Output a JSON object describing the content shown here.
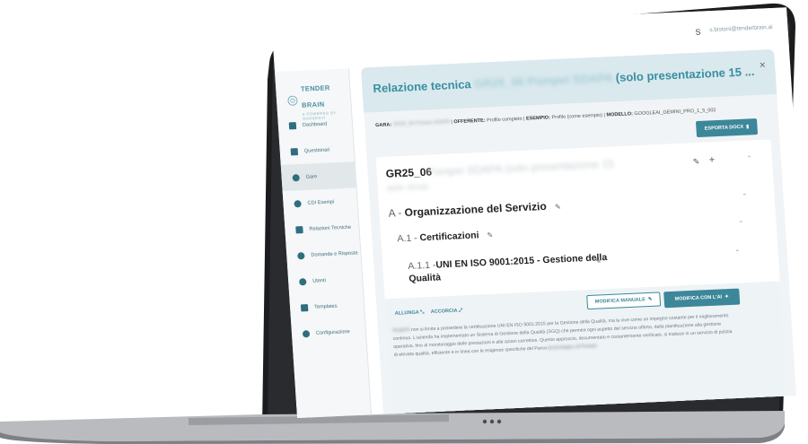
{
  "user": {
    "initial": "S",
    "email": "s.bistoni@tenderbrain.ai"
  },
  "brand": {
    "name": "TENDER BRAIN",
    "tagline": "A POWERED BY SORGENTI"
  },
  "sidebar": {
    "items": [
      {
        "label": "Dashboard",
        "icon": "dashboard-icon"
      },
      {
        "label": "Questionari",
        "icon": "questionnaire-icon"
      },
      {
        "label": "Gare",
        "icon": "tender-icon",
        "active": true
      },
      {
        "label": "CDI Esempi",
        "icon": "examples-icon"
      },
      {
        "label": "Relazioni Tecniche",
        "icon": "report-icon"
      },
      {
        "label": "Domande e Risposte",
        "icon": "qa-icon"
      },
      {
        "label": "Utenti",
        "icon": "users-icon"
      },
      {
        "label": "Templates",
        "icon": "templates-icon"
      },
      {
        "label": "Configurazione",
        "icon": "settings-icon"
      }
    ]
  },
  "card": {
    "title_prefix": "Relazione tecnica",
    "title_blur": "GR25_06 Pompei SDAPA",
    "title_suffix": "(solo presentazione 15 ...",
    "meta": {
      "gara_label": "GARA:",
      "gara_value": "GR25_06 Pompei SDAPA",
      "offerente_label": "OFFERENTE:",
      "offerente_value": "Profilo completo",
      "esempio_label": "ESEMPIO:",
      "esempio_value": "Profilo",
      "esempio_note": "(come esempio)",
      "modello_label": "MODELLO:",
      "modello_value": "GOOGLEAI_GEMINI_PRO_1_5_002"
    },
    "export_label": "ESPORTA DOCX"
  },
  "lot": {
    "code": "GR25_06",
    "name": "Pompei SDAPA (solo presentazione 15",
    "name2": "aste circa)"
  },
  "sections": {
    "a_prefix": "A -",
    "a_title": "Organizzazione del Servizio",
    "a1_prefix": "A.1 -",
    "a1_title": "Certificazioni",
    "a11_prefix": "A.1.1 -",
    "a11_title": "UNI EN ISO 9001:2015 - Gestione della Qualità"
  },
  "actions": {
    "allunga": "ALLUNGA",
    "accorcia": "ACCORCIA",
    "manual": "MODIFICA MANUALE",
    "ai": "MODIFICA CON L'AI"
  },
  "body": {
    "text_blur": "Sorgenti",
    "text": "non si limita a possedere la certificazione UNI EN ISO 9001:2015 per la Gestione della Qualità, ma la vive come un impegno costante per il miglioramento continuo. L'azienda ha implementato un Sistema di Gestione della Qualità (SGQ) che permea ogni aspetto del servizio offerto, dalla pianificazione alla gestione operativa, fino al monitoraggio delle prestazioni e alle azioni correttive. Questo approccio, documentato e costantemente verificato, si traduce in un servizio di pulizia di elevata qualità, efficiente e in linea con le esigenze specifiche del Parco",
    "text_end_blur": "Archeologico di Pompei."
  }
}
